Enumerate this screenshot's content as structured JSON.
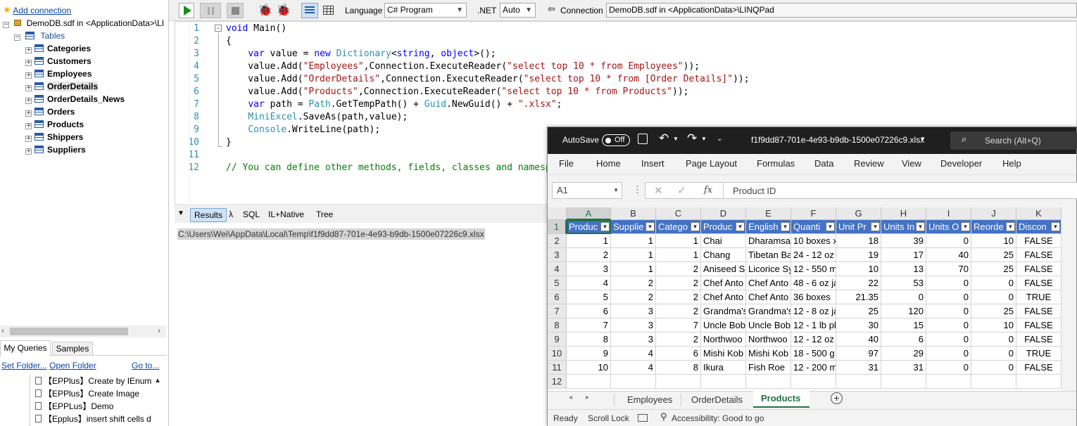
{
  "left_panel": {
    "add_connection": "Add connection",
    "db_name": "DemoDB.sdf in <ApplicationData>\\LI",
    "tables_label": "Tables",
    "tables": [
      "Categories",
      "Customers",
      "Employees",
      "OrderDetails",
      "OrderDetails_News",
      "Orders",
      "Products",
      "Shippers",
      "Suppliers"
    ],
    "selected_table": "OrderDetails",
    "tabs": [
      "My Queries",
      "Samples"
    ],
    "links": {
      "set_folder": "Set Folder...",
      "open_folder": "Open Folder",
      "go_to": "Go to..."
    },
    "queries": [
      "【EPPlus】Create by IEnume",
      "【EPPlus】Create Image",
      "【EPPLus】Demo",
      "【Epplus】insert shift cells d"
    ]
  },
  "toolbar": {
    "language_label": "Language",
    "language_value": "C# Program",
    "net_label": ".NET",
    "net_value": "Auto",
    "connection_label": "Connection",
    "connection_value": "DemoDB.sdf in <ApplicationData>\\LINQPad"
  },
  "editor": {
    "line_numbers": [
      "1",
      "2",
      "3",
      "4",
      "5",
      "6",
      "7",
      "8",
      "9",
      "10",
      "11",
      "12"
    ]
  },
  "result_tabs": [
    "Results",
    "λ",
    "SQL",
    "IL+Native",
    "Tree"
  ],
  "result_path": "C:\\Users\\Wei\\AppData\\Local\\Temp\\f1f9dd87-701e-4e93-b9db-1500e07226c9.xlsx",
  "excel": {
    "autosave_label": "AutoSave",
    "autosave_state": "Off",
    "file_name": "f1f9dd87-701e-4e93-b9db-1500e07226c9.xlsx",
    "search_placeholder": "Search (Alt+Q)",
    "menu": [
      "File",
      "Home",
      "Insert",
      "Page Layout",
      "Formulas",
      "Data",
      "Review",
      "View",
      "Developer",
      "Help"
    ],
    "name_box": "A1",
    "formula_value": "Product ID",
    "columns": [
      "A",
      "B",
      "C",
      "D",
      "E",
      "F",
      "G",
      "H",
      "I",
      "J",
      "K"
    ],
    "row_numbers": [
      "1",
      "2",
      "3",
      "4",
      "5",
      "6",
      "7",
      "8",
      "9",
      "10",
      "11",
      "12"
    ],
    "header_row": [
      "Produc",
      "Supplie",
      "Catego",
      "Produc",
      "English",
      "Quanti",
      "Unit Pr",
      "Units In",
      "Units O",
      "Reorde",
      "Discon"
    ],
    "rows": [
      [
        "1",
        "1",
        "1",
        "Chai",
        "Dharamsa",
        "10 boxes x",
        "18",
        "39",
        "0",
        "10",
        "FALSE"
      ],
      [
        "2",
        "1",
        "1",
        "Chang",
        "Tibetan Ba",
        "24 - 12 oz",
        "19",
        "17",
        "40",
        "25",
        "FALSE"
      ],
      [
        "3",
        "1",
        "2",
        "Aniseed S",
        "Licorice Sy",
        "12 - 550 m",
        "10",
        "13",
        "70",
        "25",
        "FALSE"
      ],
      [
        "4",
        "2",
        "2",
        "Chef Anto",
        "Chef Anto",
        "48 - 6 oz ja",
        "22",
        "53",
        "0",
        "0",
        "FALSE"
      ],
      [
        "5",
        "2",
        "2",
        "Chef Anto",
        "Chef Anto",
        "36 boxes",
        "21.35",
        "0",
        "0",
        "0",
        "TRUE"
      ],
      [
        "6",
        "3",
        "2",
        "Grandma's",
        "Grandma's",
        "12 - 8 oz ja",
        "25",
        "120",
        "0",
        "25",
        "FALSE"
      ],
      [
        "7",
        "3",
        "7",
        "Uncle Bob",
        "Uncle Bob",
        "12 - 1 lb pk",
        "30",
        "15",
        "0",
        "10",
        "FALSE"
      ],
      [
        "8",
        "3",
        "2",
        "Northwoo",
        "Northwoo",
        "12 - 12 oz",
        "40",
        "6",
        "0",
        "0",
        "FALSE"
      ],
      [
        "9",
        "4",
        "6",
        "Mishi Kob",
        "Mishi Kob",
        "18 - 500 g",
        "97",
        "29",
        "0",
        "0",
        "TRUE"
      ],
      [
        "10",
        "4",
        "8",
        "Ikura",
        "Fish Roe",
        "12 - 200 m",
        "31",
        "31",
        "0",
        "0",
        "FALSE"
      ]
    ],
    "sheet_tabs": [
      "Employees",
      "OrderDetails",
      "Products"
    ],
    "active_sheet": "Products",
    "status": {
      "ready": "Ready",
      "scroll_lock": "Scroll Lock",
      "accessibility": "Accessibility: Good to go"
    }
  },
  "colors": {
    "excel_green": "#217346",
    "header_blue": "#4472c4",
    "run_green": "#1a8f1a"
  }
}
